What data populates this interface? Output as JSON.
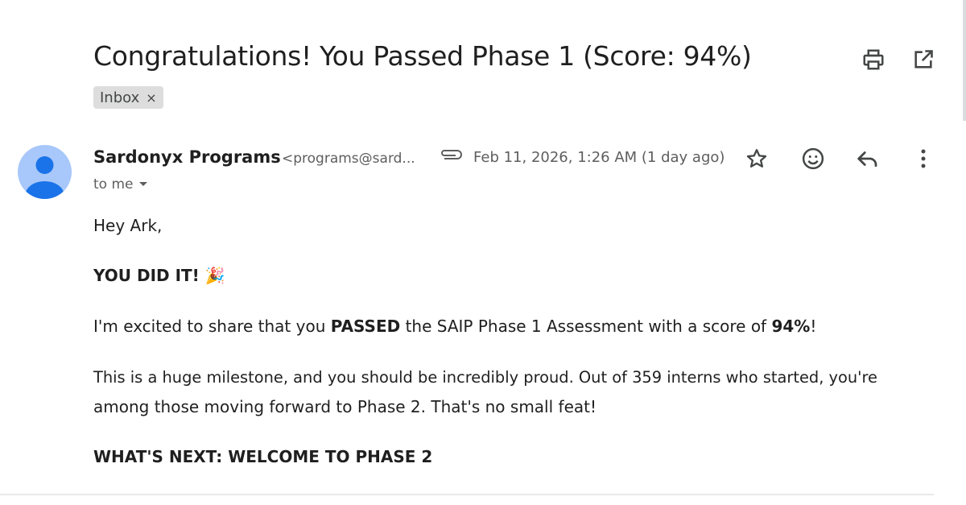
{
  "email": {
    "subject": "Congratulations! You Passed Phase 1 (Score: 94%)",
    "label": "Inbox",
    "label_remove": "×",
    "sender_name": "Sardonyx Programs",
    "sender_email": "<programs@sard...",
    "date": "Feb 11, 2026, 1:26 AM (1 day ago)",
    "recipient": "to me"
  },
  "body": {
    "greeting": "Hey Ark,",
    "headline": "YOU DID IT!",
    "headline_emoji": "🎉",
    "p1_pre": "I'm excited to share that you ",
    "p1_passed": "PASSED",
    "p1_mid": " the SAIP Phase 1 Assessment with a score of ",
    "p1_score": "94%",
    "p1_end": "!",
    "p2_line1": "This is a huge milestone, and you should be incredibly proud. Out of 359 interns who started, you're",
    "p2_line2": "among those moving forward to Phase 2. That's no small feat!",
    "next_heading": "WHAT'S NEXT: WELCOME TO PHASE 2"
  },
  "icons": {
    "print": "printer-icon",
    "open": "open-in-new-window-icon",
    "attachment": "paperclip-icon",
    "star": "star-icon",
    "emoji": "emoji-reaction-icon",
    "reply": "reply-icon",
    "more": "more-vertical-icon"
  },
  "colors": {
    "avatar_bg": "#a8c7fa",
    "avatar_fg": "#1a73e8",
    "chip_bg": "#dddddd",
    "text": "#1f1f1f",
    "muted": "#5e5e5e"
  }
}
